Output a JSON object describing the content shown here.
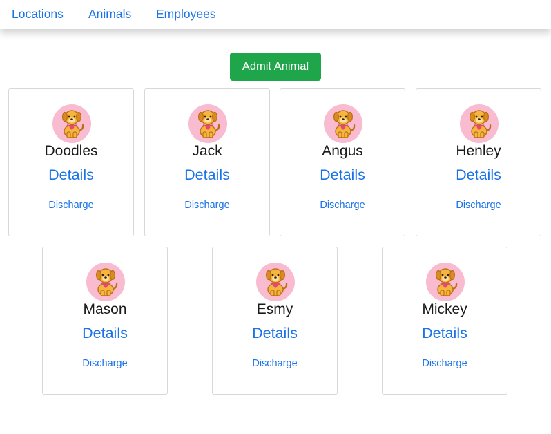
{
  "nav": {
    "items": [
      {
        "label": "Locations"
      },
      {
        "label": "Animals"
      },
      {
        "label": "Employees"
      }
    ]
  },
  "admit_button": {
    "label": "Admit Animal"
  },
  "animals": [
    {
      "name": "Doodles",
      "details": "Details",
      "discharge": "Discharge"
    },
    {
      "name": "Jack",
      "details": "Details",
      "discharge": "Discharge"
    },
    {
      "name": "Angus",
      "details": "Details",
      "discharge": "Discharge"
    },
    {
      "name": "Henley",
      "details": "Details",
      "discharge": "Discharge"
    },
    {
      "name": "Mason",
      "details": "Details",
      "discharge": "Discharge"
    },
    {
      "name": "Esmy",
      "details": "Details",
      "discharge": "Discharge"
    },
    {
      "name": "Mickey",
      "details": "Details",
      "discharge": "Discharge"
    }
  ],
  "avatar_icon": "dog-icon",
  "colors": {
    "link": "#1a73e8",
    "admit_button": "#1fa64a",
    "avatar_bg": "#f8bbd0"
  }
}
